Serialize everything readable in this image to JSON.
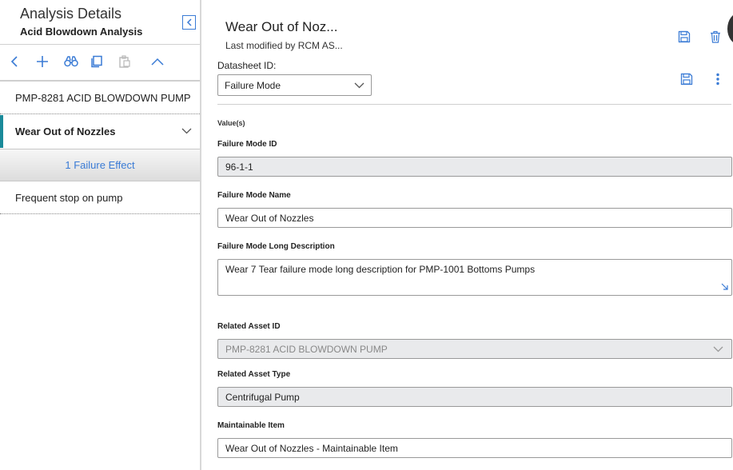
{
  "left_panel": {
    "title": "Analysis Details",
    "subtitle": "Acid Blowdown Analysis",
    "collapse_icon": "chevron-left-icon",
    "toolbar": {
      "icons": [
        "back-icon",
        "add-icon",
        "binoculars-icon",
        "copy-icon",
        "paste-icon",
        "collapse-up-icon"
      ]
    },
    "tree": {
      "asset": "PMP-8281 ACID BLOWDOWN PUMP",
      "failure_mode": "Wear Out of Nozzles",
      "failure_effect_link": "1 Failure Effect",
      "item": "Frequent stop on pump"
    }
  },
  "header": {
    "title": "Wear Out of Noz...",
    "modified": "Last modified by RCM AS...",
    "icons": [
      "save-icon",
      "delete-icon"
    ]
  },
  "datasheet": {
    "label": "Datasheet ID:",
    "selected": "Failure Mode",
    "icons": [
      "save-icon",
      "more-icon"
    ]
  },
  "form": {
    "section": "Value(s)",
    "failure_mode_id": {
      "label": "Failure Mode ID",
      "value": "96-1-1"
    },
    "failure_mode_name": {
      "label": "Failure Mode Name",
      "value": "Wear Out of Nozzles"
    },
    "long_description": {
      "label": "Failure Mode Long Description",
      "value": "Wear 7 Tear failure mode long description for PMP-1001 Bottoms Pumps"
    },
    "related_asset_id": {
      "label": "Related Asset ID",
      "value": "PMP-8281 ACID BLOWDOWN PUMP"
    },
    "related_asset_type": {
      "label": "Related Asset Type",
      "value": "Centrifugal Pump"
    },
    "maintainable_item": {
      "label": "Maintainable Item",
      "value": "Wear Out of Nozzles - Maintainable Item"
    }
  },
  "colors": {
    "accent": "#3a7bd5",
    "selected_marker": "#1a8a9a"
  }
}
